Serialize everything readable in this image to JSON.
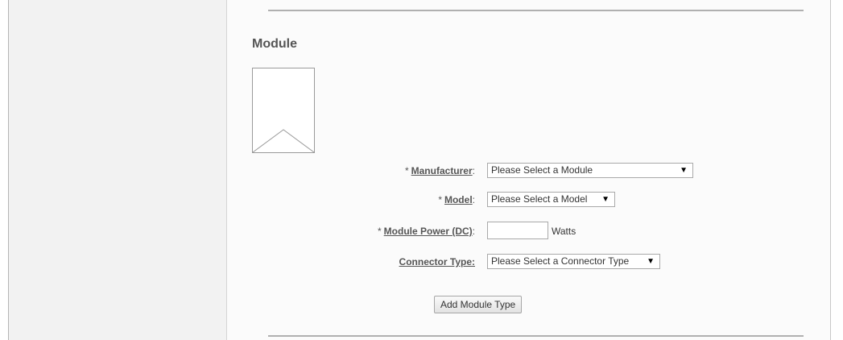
{
  "section": {
    "title": "Module"
  },
  "form": {
    "manufacturer": {
      "required_mark": "*",
      "label": "Manufacturer",
      "colon": ":",
      "selected": "Please Select a Module",
      "arrow": "▼"
    },
    "model": {
      "required_mark": "*",
      "label": "Model",
      "colon": ":",
      "selected": "Please Select a Model",
      "arrow": "▼"
    },
    "module_power": {
      "required_mark": "*",
      "label": "Module Power (DC)",
      "colon": ":",
      "value": "",
      "unit": "Watts"
    },
    "connector_type": {
      "label": "Connector Type:",
      "selected": "Please Select a Connector Type",
      "arrow": "▼"
    },
    "add_button_label": "Add Module Type"
  },
  "icons": {
    "dropdown": "▼",
    "image_placeholder": "image-placeholder-icon"
  },
  "colors": {
    "sidebar_bg": "#f2f2f2",
    "label_text": "#555555",
    "rule": "#b0b0b0"
  }
}
